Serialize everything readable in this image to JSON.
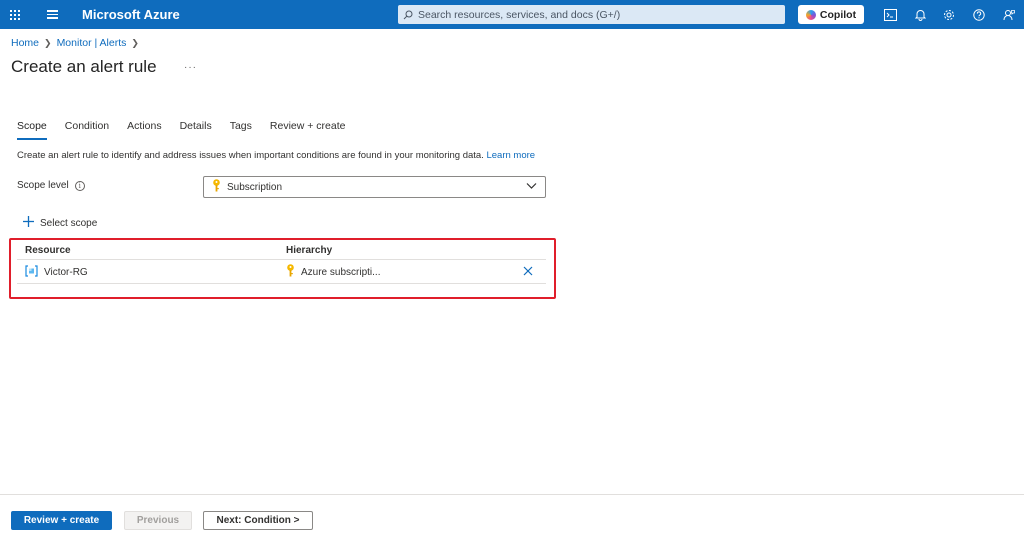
{
  "topbar": {
    "brand": "Microsoft Azure",
    "search_placeholder": "Search resources, services, and docs (G+/)",
    "copilot_label": "Copilot"
  },
  "breadcrumb": {
    "items": [
      "Home",
      "Monitor | Alerts"
    ]
  },
  "page": {
    "title": "Create an alert rule",
    "more": "···"
  },
  "tabs": [
    {
      "label": "Scope",
      "active": true
    },
    {
      "label": "Condition"
    },
    {
      "label": "Actions"
    },
    {
      "label": "Details"
    },
    {
      "label": "Tags"
    },
    {
      "label": "Review + create"
    }
  ],
  "description": {
    "text": "Create an alert rule to identify and address issues when important conditions are found in your monitoring data.",
    "link": "Learn more"
  },
  "scope_level": {
    "label": "Scope level",
    "value": "Subscription"
  },
  "select_scope_label": "Select scope",
  "table": {
    "headers": [
      "Resource",
      "Hierarchy"
    ],
    "rows": [
      {
        "resource": "Victor-RG",
        "hierarchy": "Azure subscripti..."
      }
    ]
  },
  "footer": {
    "review_create": "Review + create",
    "previous": "Previous",
    "next": "Next: Condition >"
  },
  "colors": {
    "accent": "#0f6cbd",
    "highlight": "#e01e2b"
  }
}
